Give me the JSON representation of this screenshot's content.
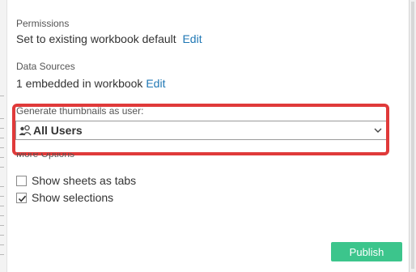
{
  "permissions": {
    "label": "Permissions",
    "value": "Set to existing workbook default",
    "edit_link": "Edit"
  },
  "data_sources": {
    "label": "Data Sources",
    "value": "1 embedded in workbook",
    "edit_link": "Edit"
  },
  "thumbnails": {
    "label": "Generate thumbnails as user:",
    "selected": "All Users",
    "icon": "users-icon"
  },
  "more_options": {
    "label": "More Options",
    "options": [
      {
        "label": "Show sheets as tabs",
        "checked": false
      },
      {
        "label": "Show selections",
        "checked": true
      }
    ]
  },
  "publish_button": {
    "label": "Publish"
  },
  "colors": {
    "accent": "#3cc58c",
    "link": "#1f77b4",
    "highlight": "#e03a3a"
  }
}
